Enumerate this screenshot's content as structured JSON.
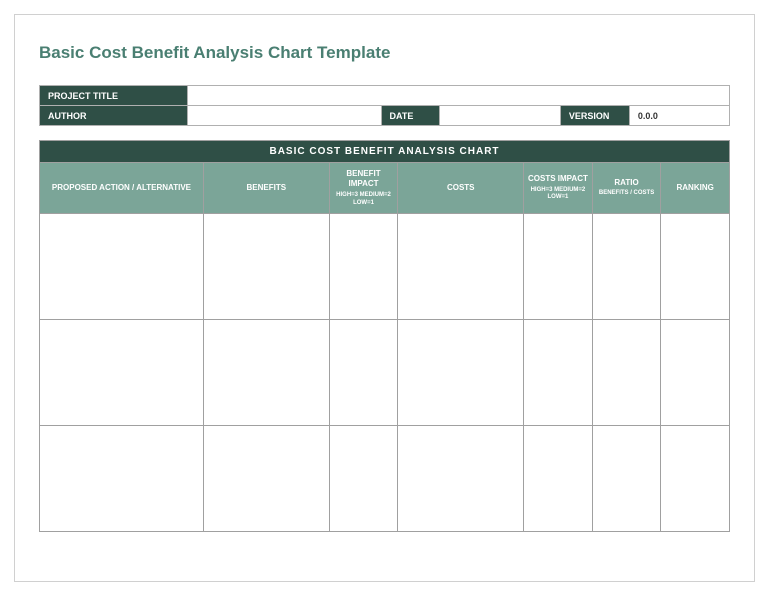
{
  "title": "Basic Cost Benefit Analysis Chart Template",
  "meta": {
    "projectTitleLabel": "PROJECT TITLE",
    "projectTitleValue": "",
    "authorLabel": "AUTHOR",
    "authorValue": "",
    "dateLabel": "DATE",
    "dateValue": "",
    "versionLabel": "VERSION",
    "versionValue": "0.0.0"
  },
  "chart": {
    "heading": "BASIC COST BENEFIT ANALYSIS CHART",
    "headers": {
      "proposedAction": "PROPOSED ACTION / ALTERNATIVE",
      "benefits": "BENEFITS",
      "benefitImpact": "BENEFIT IMPACT",
      "benefitImpactScale": "HIGH=3 MEDIUM=2 LOW=1",
      "costs": "COSTS",
      "costsImpact": "COSTS IMPACT",
      "costsImpactScale": "HIGH=3 MEDIUM=2 LOW=1",
      "ratio": "RATIO",
      "ratioSub": "BENEFITS / COSTS",
      "ranking": "RANKING"
    },
    "rows": [
      {
        "action": "",
        "benefits": "",
        "bimpact": "",
        "costs": "",
        "cimpact": "",
        "ratio": "",
        "ranking": ""
      },
      {
        "action": "",
        "benefits": "",
        "bimpact": "",
        "costs": "",
        "cimpact": "",
        "ratio": "",
        "ranking": ""
      },
      {
        "action": "",
        "benefits": "",
        "bimpact": "",
        "costs": "",
        "cimpact": "",
        "ratio": "",
        "ranking": ""
      }
    ]
  }
}
